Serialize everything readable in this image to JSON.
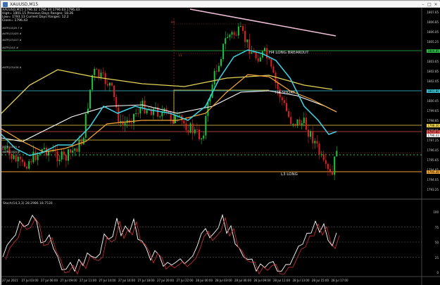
{
  "window": {
    "title": "XAUUSD,M15"
  },
  "info_lines": [
    "XAUUSD,M15  1796.32 1796.34 1796.63 1796.43",
    "High= 1801.15   Previous Days Ranges: 18.26",
    "Low= 1793.13    Current Days Ranges: 12.2",
    "Close= 1796.43"
  ],
  "object_labels": [
    "#ATR(14)25.7 #",
    "#ATR(13)425 #",
    "#ATR(13)417 #",
    "#ATR(14)1 #",
    "#ATR(13)418 #",
    "#ATR(14)25 #",
    "#ATR(14)25 #"
  ],
  "annotations": {
    "h4_long_breakout": "H4 LONG BREAKOUT",
    "h3_short": "H3 SHORT",
    "l3_long": "L3 LONG",
    "l1": "L1",
    "h1": "H1"
  },
  "indicator_label": "Stoch(14,3,3) 28.2986 18.7530",
  "price_scale": [
    "1807.65",
    "1806.85",
    "1806.05",
    "1805.25",
    "1804.45",
    "1803.65",
    "1802.85",
    "1802.05",
    "1801.25",
    "1800.45",
    "1799.65",
    "1798.85",
    "1798.05",
    "1797.25",
    "1796.45",
    "1795.65",
    "1794.85",
    "1794.05",
    "1793.25"
  ],
  "price_tags": [
    {
      "text": "1804.85",
      "color": "#2fbf4a"
    },
    {
      "text": "1801.80",
      "color": "#37c6d6"
    },
    {
      "text": "1798.30",
      "color": "#f0d34a"
    },
    {
      "text": "1797.85",
      "color": "#e05050"
    },
    {
      "text": "1796.43",
      "color": "#ffffff"
    },
    {
      "text": "1795.30",
      "color": "#f2a230"
    }
  ],
  "stoch_scale": [
    "100",
    "75",
    "50",
    "25",
    "0"
  ],
  "time_labels": [
    "27 Jul 2021",
    "27 Jul 03:00",
    "27 Jul 06:00",
    "27 Jul 09:00",
    "27 Jul 11:00",
    "27 Jul 14:00",
    "27 Jul 16:00",
    "27 Jul 18:00",
    "27 Jul 20:00",
    "27 Jul 22:00",
    "28 Jul 00:00",
    "28 Jul 03:00",
    "28 Jul 06:00",
    "28 Jul 09:00",
    "28 Jul 11:00",
    "28 Jul 13:00",
    "28 Jul 15:00",
    "28 Jul 17:00"
  ]
}
